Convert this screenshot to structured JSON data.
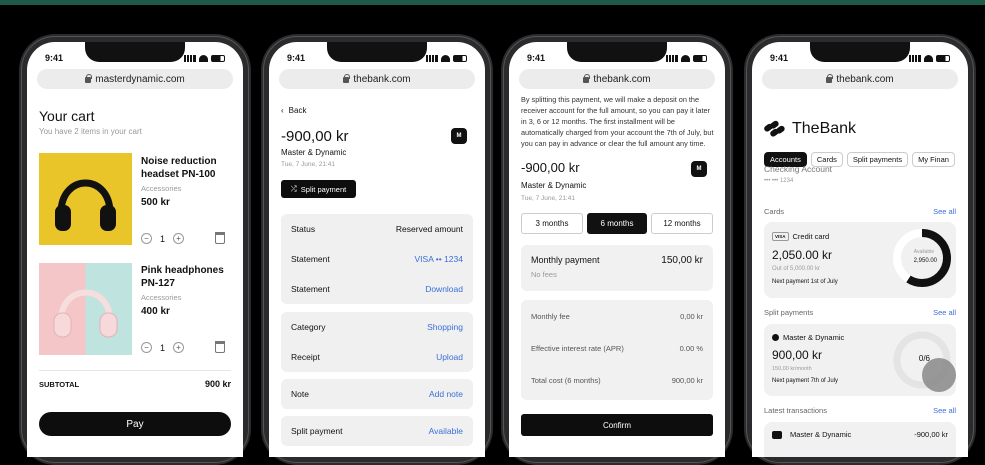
{
  "status_time": "9:41",
  "phones": {
    "p1": {
      "url": "masterdynamic.com",
      "title": "Your cart",
      "subtitle": "You have 2 items in your cart",
      "items": [
        {
          "name": "Noise reduction headset PN-100",
          "category": "Accessories",
          "price": "500 kr",
          "qty": "1"
        },
        {
          "name": "Pink headphones PN-127",
          "category": "Accessories",
          "price": "400 kr",
          "qty": "1"
        }
      ],
      "subtotal_label": "SUBTOTAL",
      "subtotal_value": "900 kr",
      "pay_label": "Pay"
    },
    "p2": {
      "url": "thebank.com",
      "back": "Back",
      "amount": "-900,00 kr",
      "merchant": "Master & Dynamic",
      "date": "Tue, 7 June, 21:41",
      "split_btn": "Split payment",
      "rows": [
        {
          "label": "Status",
          "value": "Reserved amount"
        },
        {
          "label": "Statement",
          "value": "VISA •• 1234"
        },
        {
          "label": "Statement",
          "value": "Download"
        },
        {
          "label": "Category",
          "value": "Shopping"
        },
        {
          "label": "Receipt",
          "value": "Upload"
        },
        {
          "label": "Note",
          "value": "Add note"
        },
        {
          "label": "Split payment",
          "value": "Available"
        }
      ],
      "logo_text": "M"
    },
    "p3": {
      "url": "thebank.com",
      "intro": "By splitting this payment, we will make a deposit on the receiver account for the full amount, so you can pay it later in 3, 6 or 12 months. The first installment will be automatically charged from your account the 7th of July, but you can pay in advance or clear the full amount any time.",
      "amount": "-900,00 kr",
      "merchant": "Master & Dynamic",
      "date": "Tue, 7 June, 21:41",
      "tabs": [
        "3 months",
        "6 months",
        "12 months"
      ],
      "monthly_label": "Monthly payment",
      "monthly_value": "150,00 kr",
      "no_fees": "No fees",
      "rows": [
        {
          "label": "Monthly fee",
          "value": "0,00 kr"
        },
        {
          "label": "Effective interest rate (APR)",
          "value": "0.00 %"
        },
        {
          "label": "Total cost (6 months)",
          "value": "900,00 kr"
        }
      ],
      "confirm": "Confirm",
      "logo_text": "M"
    },
    "p4": {
      "url": "thebank.com",
      "brand": "TheBank",
      "tabs": [
        "Accounts",
        "Cards",
        "Split payments",
        "My Finan"
      ],
      "checking_label": "Checking Account",
      "checking_num": "••• ••• 1234",
      "cards_label": "Cards",
      "see_all": "See all",
      "credit": {
        "badge": "VISA",
        "title": "Credit card",
        "amount": "2,050.00 kr",
        "out_of": "Out of 5,000.00 kr",
        "next": "Next payment 1st of July",
        "ring_label": "Available",
        "ring_value": "2,950.00",
        "available_fraction": 0.59
      },
      "split_label": "Split payments",
      "split": {
        "merchant": "Master & Dynamic",
        "amount": "900,00 kr",
        "per_month": "150,00 kr/month",
        "next": "Next payment 7th of July",
        "progress": "0/6"
      },
      "latest_label": "Latest transactions",
      "latest": {
        "merchant": "Master & Dynamic",
        "amount": "-900,00 kr"
      }
    }
  }
}
